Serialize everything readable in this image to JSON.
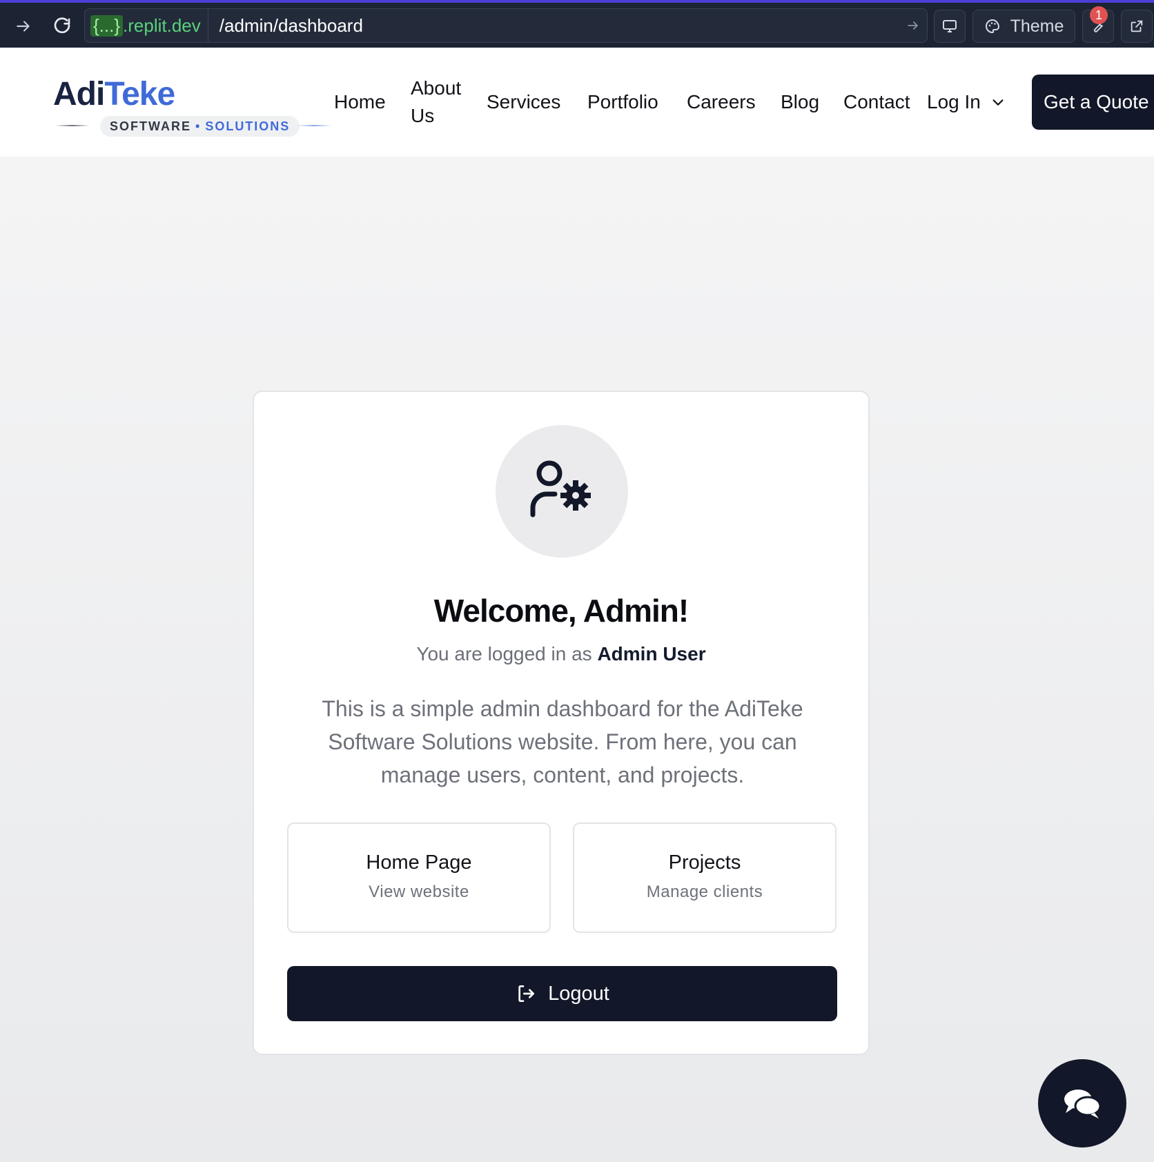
{
  "browser": {
    "url_host_brace": "{...}",
    "url_host_domain": ".replit.dev",
    "url_path": "/admin/dashboard",
    "theme_label": "Theme",
    "badge_count": "1"
  },
  "header": {
    "logo": {
      "part1": "Adi",
      "part2": "Teke",
      "sub1": "SOFTWARE",
      "sub_sep": "•",
      "sub2": "SOLUTIONS"
    },
    "nav": {
      "home": "Home",
      "about_line1": "About",
      "about_line2": "Us",
      "services": "Services",
      "portfolio": "Portfolio",
      "careers": "Careers",
      "blog": "Blog",
      "contact": "Contact",
      "login": "Log In"
    },
    "cta": "Get a Quote"
  },
  "dashboard": {
    "title": "Welcome, Admin!",
    "logged_prefix": "You are logged in as",
    "user_name": "Admin User",
    "description": "This is a simple admin dashboard for the AdiTeke Software Solutions website. From here, you can manage users, content, and projects.",
    "tiles": [
      {
        "title": "Home Page",
        "subtitle": "View website"
      },
      {
        "title": "Projects",
        "subtitle": "Manage clients"
      }
    ],
    "logout_label": "Logout"
  },
  "colors": {
    "brand_dark": "#121829",
    "brand_blue": "#3f6ad8",
    "chrome_bg": "#1c2333",
    "host_green": "#59d37a"
  }
}
